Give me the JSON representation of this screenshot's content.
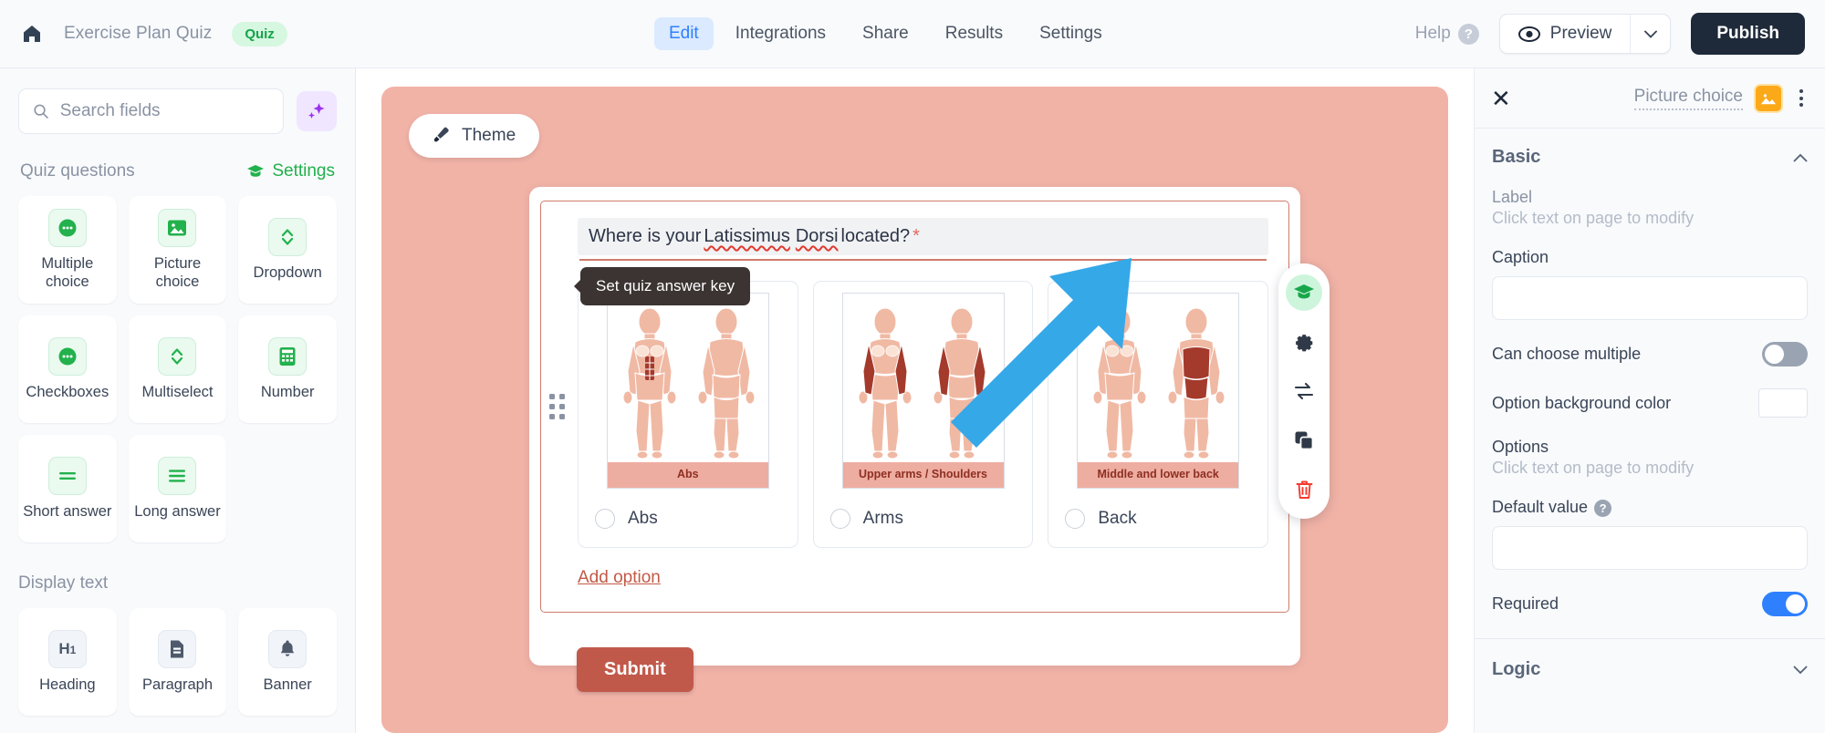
{
  "topbar": {
    "home_icon": "home-icon",
    "doc_title": "Exercise Plan Quiz",
    "badge": "Quiz",
    "tabs": [
      {
        "label": "Edit",
        "active": true
      },
      {
        "label": "Integrations",
        "active": false
      },
      {
        "label": "Share",
        "active": false
      },
      {
        "label": "Results",
        "active": false
      },
      {
        "label": "Settings",
        "active": false
      }
    ],
    "help_label": "Help",
    "help_icon": "question-mark-icon",
    "preview_label": "Preview",
    "preview_icon": "eye-icon",
    "preview_caret_icon": "chevron-down-icon",
    "publish_label": "Publish"
  },
  "sidebar": {
    "search_placeholder": "Search fields",
    "search_value": "",
    "search_icon": "search-icon",
    "ai_icon": "sparkles-icon",
    "quiz_section_title": "Quiz questions",
    "settings_label": "Settings",
    "settings_icon": "graduation-cap-icon",
    "quiz_fields": [
      {
        "label": "Multiple choice",
        "icon": "chat-bubble-dots-icon",
        "style": "green"
      },
      {
        "label": "Picture choice",
        "icon": "image-icon",
        "style": "green"
      },
      {
        "label": "Dropdown",
        "icon": "chevron-up-down-icon",
        "style": "green"
      },
      {
        "label": "Checkboxes",
        "icon": "chat-bubble-dots-icon",
        "style": "green"
      },
      {
        "label": "Multiselect",
        "icon": "chevron-up-down-icon",
        "style": "green"
      },
      {
        "label": "Number",
        "icon": "calculator-icon",
        "style": "green"
      },
      {
        "label": "Short answer",
        "icon": "two-lines-icon",
        "style": "green"
      },
      {
        "label": "Long answer",
        "icon": "three-lines-icon",
        "style": "green"
      }
    ],
    "display_section_title": "Display text",
    "display_fields": [
      {
        "label": "Heading",
        "icon": "h1-icon",
        "style": "gray"
      },
      {
        "label": "Paragraph",
        "icon": "document-icon",
        "style": "gray"
      },
      {
        "label": "Banner",
        "icon": "bell-icon",
        "style": "gray"
      }
    ]
  },
  "canvas": {
    "theme_label": "Theme",
    "theme_icon": "paintbrush-icon",
    "theme_background_color": "#f2b3a7",
    "question": {
      "text_before": "Where is your ",
      "misspelled_1": "Latissimus",
      "text_middle": " ",
      "misspelled_2": "Dorsi",
      "text_after": " located?",
      "required_marker": "*"
    },
    "options": [
      {
        "caption": "Abs",
        "label": "Abs",
        "selected": false
      },
      {
        "caption": "Upper arms / Shoulders",
        "label": "Arms",
        "selected": false
      },
      {
        "caption": "Middle and lower back",
        "label": "Back",
        "selected": false
      }
    ],
    "add_option_label": "Add option",
    "submit_label": "Submit",
    "submit_color": "#c1594a",
    "tooltip_text": "Set quiz answer key",
    "tool_buttons": [
      {
        "name": "set-quiz-answer-key",
        "icon": "graduation-cap-icon",
        "active": true
      },
      {
        "name": "field-settings",
        "icon": "gear-icon",
        "active": false
      },
      {
        "name": "swap-field",
        "icon": "swap-arrows-icon",
        "active": false
      },
      {
        "name": "duplicate-field",
        "icon": "copy-icon",
        "active": false
      },
      {
        "name": "delete-field",
        "icon": "trash-icon",
        "active": false
      }
    ],
    "arrow_color": "#35a8e8"
  },
  "right_panel": {
    "close_icon": "close-icon",
    "title": "Picture choice",
    "type_icon": "image-icon",
    "type_icon_color": "#fba919",
    "kebab_icon": "more-vertical-icon",
    "basic_section": "Basic",
    "basic_chevron": "chevron-up-icon",
    "label_field_title": "Label",
    "label_field_hint": "Click text on page to modify",
    "caption_label": "Caption",
    "caption_value": "",
    "can_choose_multiple_label": "Can choose multiple",
    "can_choose_multiple_on": false,
    "option_bg_color_label": "Option background color",
    "option_bg_color_value": "#ffffff",
    "options_title": "Options",
    "options_hint": "Click text on page to modify",
    "default_value_label": "Default value",
    "default_value_help_icon": "question-mark-icon",
    "default_value": "",
    "required_label": "Required",
    "required_on": true,
    "logic_section": "Logic",
    "logic_chevron": "chevron-down-icon"
  }
}
